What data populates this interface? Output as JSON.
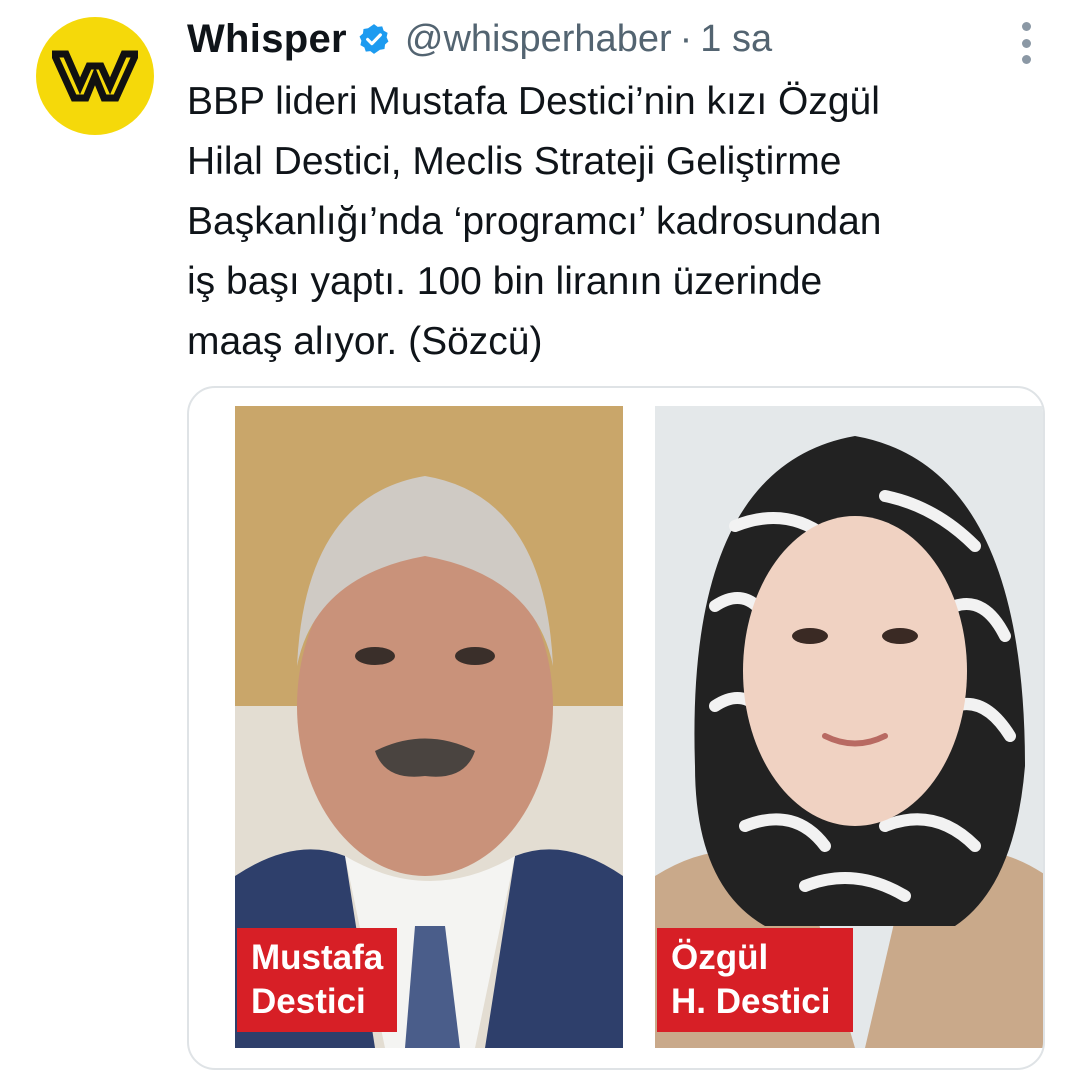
{
  "tweet": {
    "author_name": "Whisper",
    "handle": "@whisperhaber",
    "separator": "·",
    "time": "1 sa",
    "text": "BBP lideri Mustafa Destici’nin kızı Özgül\nHilal Destici, Meclis Strateji Geliştirme\nBaşkanlığı’nda ‘programcı’ kadrosundan\niş başı yaptı. 100 bin liranın üzerinde\nmaaş alıyor. (Sözcü)"
  },
  "media": {
    "left_caption": [
      "Mustafa",
      "Destici"
    ],
    "right_caption": [
      "Özgül",
      "H. Destici"
    ]
  },
  "icons": {
    "avatar": "whisper-w-logo",
    "verified": "verified-badge-icon",
    "more": "more-options-icon"
  },
  "colors": {
    "avatar_bg": "#f5d90a",
    "verified": "#1d9bf0",
    "caption_bg": "#d71f26",
    "muted_text": "#536471"
  }
}
